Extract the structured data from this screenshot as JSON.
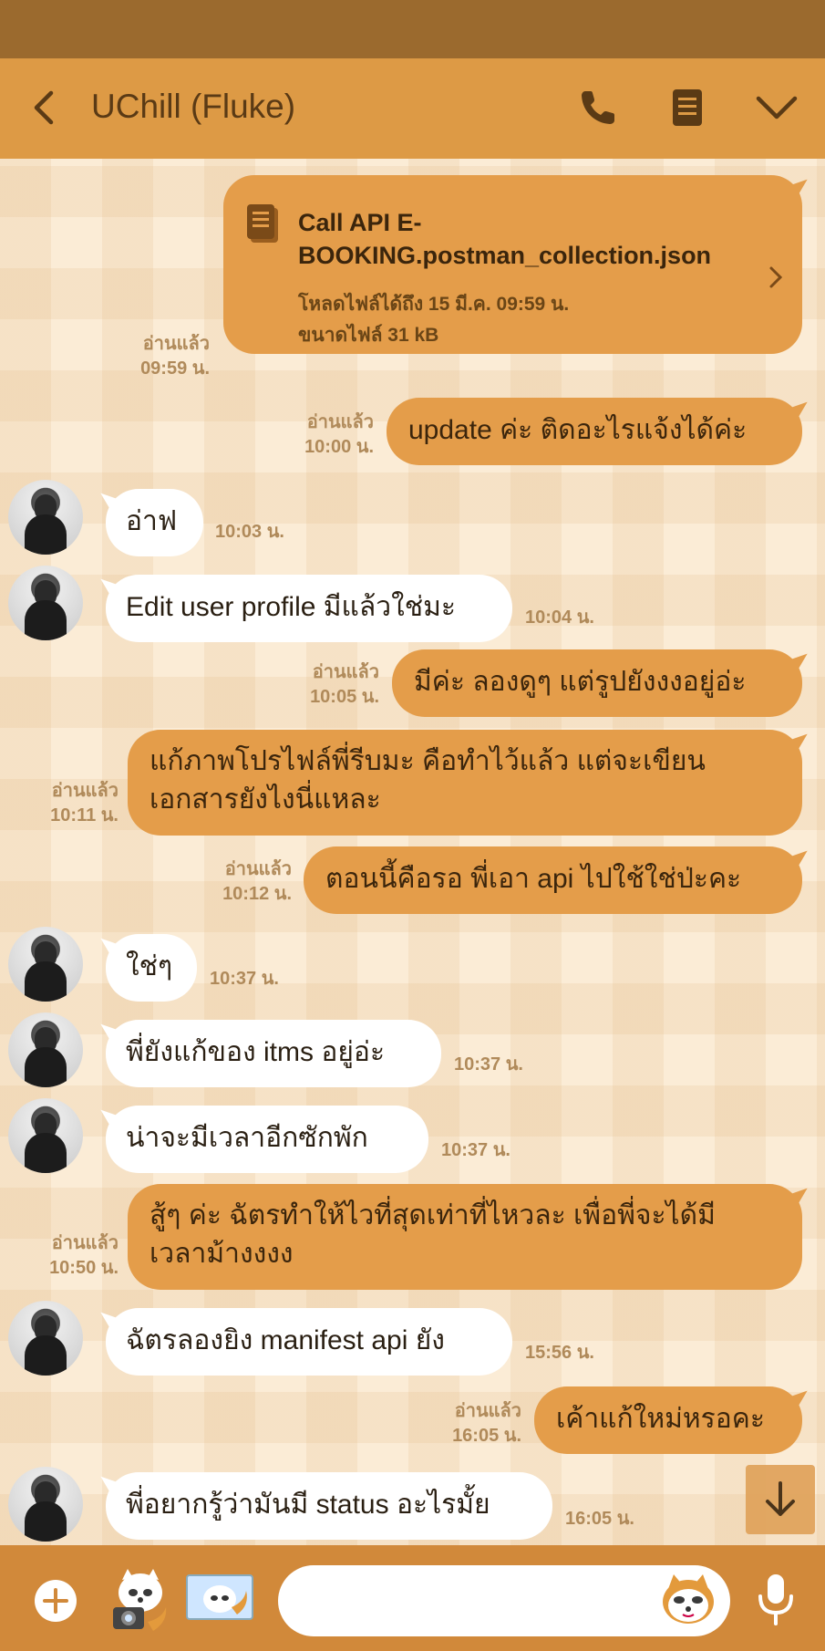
{
  "header": {
    "title": "UChill (Fluke)",
    "back_icon": "chevron-left-icon",
    "call_icon": "phone-icon",
    "notes_icon": "notes-icon",
    "menu_icon": "chevron-down-icon"
  },
  "colors": {
    "status_bar": "#9b6a2e",
    "header": "#dd9a45",
    "outgoing_bubble": "#e49d4a",
    "incoming_bubble": "#ffffff",
    "bottom_bar": "#d1893a"
  },
  "file_message": {
    "name": "Call API E-BOOKING.postman_collection.json",
    "download_until": "โหลดไฟล์ได้ถึง 15 มี.ค. 09:59 น.",
    "size": "ขนาดไฟล์ 31 kB",
    "read_label": "อ่านแล้ว",
    "time": "09:59 น."
  },
  "messages": [
    {
      "side": "out",
      "text": "update ค่ะ ติดอะไรแจ้งได้ค่ะ",
      "read": "อ่านแล้ว",
      "time": "10:00 น."
    },
    {
      "side": "in",
      "text": "อ่าฟ",
      "time": "10:03 น."
    },
    {
      "side": "in",
      "text": "Edit user profile มีแล้วใช่มะ",
      "time": "10:04 น."
    },
    {
      "side": "out",
      "text": "มีค่ะ ลองดูๆ แต่รูปยังงงอยู่อ่ะ",
      "read": "อ่านแล้ว",
      "time": "10:05 น."
    },
    {
      "side": "out",
      "text": "แก้ภาพโปรไฟล์พี่รีบมะ คือทำไว้แล้ว แต่จะเขียน",
      "text2": "เอกสารยังไงนี่แหละ",
      "read": "อ่านแล้ว",
      "time": "10:11 น."
    },
    {
      "side": "out",
      "text": "ตอนนี้คือรอ พี่เอา api ไปใช้ใช่ป่ะคะ",
      "read": "อ่านแล้ว",
      "time": "10:12 น."
    },
    {
      "side": "in",
      "text": "ใช่ๆ",
      "time": "10:37 น."
    },
    {
      "side": "in",
      "text": "พี่ยังแก้ของ itms อยู่อ่ะ",
      "time": "10:37 น."
    },
    {
      "side": "in",
      "text": "น่าจะมีเวลาอีกซักพัก",
      "time": "10:37 น."
    },
    {
      "side": "out",
      "text": "สู้ๆ ค่ะ ฉัตรทำให้ไวที่สุดเท่าที่ไหวละ เพื่อพี่จะได้มี",
      "text2": "เวลาม้างงงง",
      "read": "อ่านแล้ว",
      "time": "10:50 น."
    },
    {
      "side": "in",
      "text": "ฉัตรลองยิง manifest api ยัง",
      "time": "15:56 น."
    },
    {
      "side": "out",
      "text": "เค้าแก้ใหม่หรอคะ",
      "read": "อ่านแล้ว",
      "time": "16:05 น."
    },
    {
      "side": "in",
      "text": "พี่อยากรู้ว่ามันมี status อะไรมั้ย",
      "time": "16:05 น."
    }
  ],
  "bottom_bar": {
    "add_icon": "plus-circle-icon",
    "camera_icon": "camera-sticker-icon",
    "image_icon": "gallery-sticker-icon",
    "sticker_icon": "sticker-face-icon",
    "mic_icon": "microphone-icon",
    "input_placeholder": ""
  },
  "scroll_icon": "arrow-down-icon"
}
